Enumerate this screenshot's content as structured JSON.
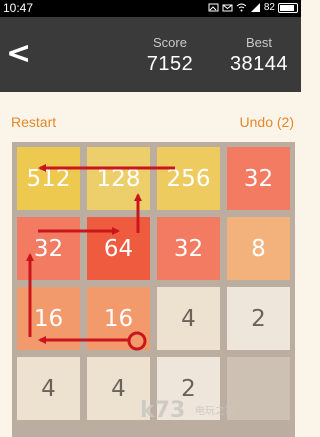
{
  "statusbar": {
    "time": "10:47",
    "battery": "82"
  },
  "header": {
    "back_icon": "<",
    "score_label": "Score",
    "score_value": "7152",
    "best_label": "Best",
    "best_value": "38144"
  },
  "actions": {
    "restart": "Restart",
    "undo": "Undo (2)"
  },
  "colors": {
    "accent": "#e4872d",
    "header_bg": "#3a3a3a",
    "board_bg": "#bbad9f",
    "tile_512": "#eec94f",
    "tile_128": "#eccf6b",
    "tile_256": "#edcb5e",
    "tile_64": "#ef5b3f",
    "tile_32": "#f27b62",
    "tile_16": "#f29a6b",
    "tile_8": "#f3b27b",
    "tile_4": "#ece2cf",
    "tile_2": "#eee6da",
    "tile_empty": "#cdc1b3",
    "annotation": "#c9151b"
  },
  "board": {
    "rows": [
      [
        "512",
        "128",
        "256",
        "32"
      ],
      [
        "32",
        "64",
        "32",
        "8"
      ],
      [
        "16",
        "16",
        "4",
        "2"
      ],
      [
        "4",
        "4",
        "2",
        ""
      ]
    ]
  },
  "watermark": {
    "text": "k73",
    "sub": "电玩之家"
  }
}
